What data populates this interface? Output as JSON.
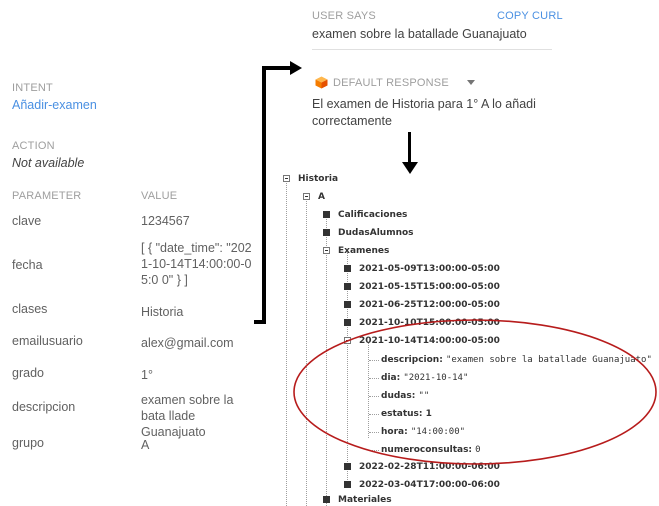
{
  "user_says": {
    "label": "USER SAYS",
    "copy_label": "COPY CURL",
    "text": "examen sobre la batallade Guanajuato"
  },
  "intent": {
    "label": "INTENT",
    "value": "Añadir-examen"
  },
  "action": {
    "label": "ACTION",
    "value": "Not available"
  },
  "parameters": {
    "header_parameter": "PARAMETER",
    "header_value": "VALUE",
    "rows": [
      {
        "name": "clave",
        "value": "1234567"
      },
      {
        "name": "fecha",
        "value": "[ { \"date_time\": \"2021-10-14T14:00:00-05:0 0\" } ]"
      },
      {
        "name": "clases",
        "value": "Historia"
      },
      {
        "name": "emailusuario",
        "value": "alex@gmail.com"
      },
      {
        "name": "grado",
        "value": "1°"
      },
      {
        "name": "descripcion",
        "value": "examen sobre la bata llade Guanajuato"
      },
      {
        "name": "grupo",
        "value": "A"
      }
    ]
  },
  "response": {
    "title": "DEFAULT RESPONSE",
    "text": "El examen de Historia para 1° A lo añadi correctamente"
  },
  "tree": {
    "root": "Historia",
    "group": "A",
    "nodes": [
      "Calificaciones",
      "DudasAlumnos",
      "Examenes"
    ],
    "dates": [
      "2021-05-09T13:00:00-05:00",
      "2021-05-15T15:00:00-05:00",
      "2021-06-25T12:00:00-05:00",
      "2021-10-10T15:00:00-05:00",
      "2021-10-14T14:00:00-05:00"
    ],
    "fields": [
      {
        "key": "descripcion:",
        "value": "\"examen sobre la batallade Guanajuato\""
      },
      {
        "key": "dia:",
        "value": "\"2021-10-14\""
      },
      {
        "key": "dudas:",
        "value": "\"\""
      },
      {
        "key": "estatus:",
        "value": "1"
      },
      {
        "key": "hora:",
        "value": "\"14:00:00\""
      },
      {
        "key": "numeroconsultas:",
        "value": "0"
      }
    ],
    "more_dates": [
      "2022-02-28T11:00:00-06:00",
      "2022-03-04T17:00:00-06:00"
    ],
    "last": "Materiales"
  },
  "colors": {
    "accent": "#4a90e2",
    "highlight_ellipse": "#b71c1c",
    "response_icon": "#f57c00"
  }
}
